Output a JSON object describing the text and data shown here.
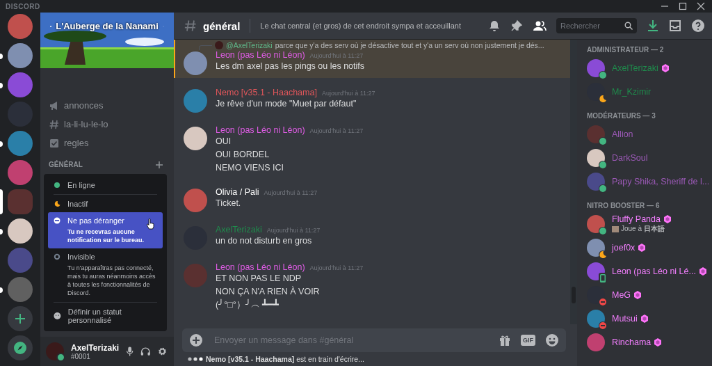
{
  "app_title": "DISCORD",
  "servers": [
    {
      "selected": false,
      "unread": false
    },
    {
      "selected": false,
      "unread": true
    },
    {
      "selected": false,
      "unread": true
    },
    {
      "selected": false,
      "unread": false
    },
    {
      "selected": false,
      "unread": true
    },
    {
      "selected": false,
      "unread": false
    },
    {
      "selected": true,
      "unread": false
    },
    {
      "selected": false,
      "unread": true
    },
    {
      "selected": false,
      "unread": false
    },
    {
      "selected": false,
      "unread": true
    }
  ],
  "guild": {
    "name": "L'Auberge de la Nanami"
  },
  "channels": [
    {
      "kind": "announcement",
      "name": "annonces"
    },
    {
      "kind": "text",
      "name": "la-li-lu-le-lo"
    },
    {
      "kind": "rules",
      "name": "regles"
    }
  ],
  "category": "GÉNÉRAL",
  "status_menu": [
    {
      "kind": "online",
      "label": "En ligne",
      "selected": false
    },
    {
      "kind": "idle",
      "label": "Inactif",
      "selected": false
    },
    {
      "kind": "dnd",
      "label": "Ne pas déranger",
      "description": "Tu ne recevras aucune notification sur le bureau.",
      "selected": true
    },
    {
      "kind": "invisible",
      "label": "Invisible",
      "description": "Tu n'apparaîtras pas connecté, mais tu auras néanmoins accès à toutes les fonctionnalités de Discord.",
      "selected": false
    },
    {
      "kind": "custom",
      "label": "Définir un statut personnalisé",
      "selected": false
    }
  ],
  "user": {
    "name": "AxelTerizaki",
    "tag": "#0001",
    "kind": "online"
  },
  "channel_header": {
    "name": "général",
    "topic": "Le chat central (et gros) de cet endroit sympa et acceuillant",
    "search_placeholder": "Rechercher"
  },
  "messages": [
    {
      "author": "Leon (pas Léo ni Léon)",
      "color": "#e05de6",
      "time": "Aujourd'hui à 11:27",
      "highlighted": true,
      "reply": {
        "mention": "@AxelTerizaki",
        "text": "parce que y'a des serv où je désactive tout et y'a un serv où non justement je dés..."
      },
      "lines": [
        "Les dm axel pas les pings ou les notifs"
      ]
    },
    {
      "author": "Nemo [v35.1 - Haachama]",
      "color": "#e0565a",
      "time": "Aujourd'hui à 11:27",
      "highlighted": false,
      "lines": [
        "Je rêve d'un mode \"Muet par défaut\""
      ]
    },
    {
      "author": "Leon (pas Léo ni Léon)",
      "color": "#e05de6",
      "time": "Aujourd'hui à 11:27",
      "highlighted": false,
      "lines": [
        "OUI",
        "OUI BORDEL",
        "NEMO VIENS ICI"
      ]
    },
    {
      "author": "Olivia / Pali",
      "color": "#ffffff",
      "time": "Aujourd'hui à 11:27",
      "highlighted": false,
      "lines": [
        "Ticket."
      ]
    },
    {
      "author": "AxelTerizaki",
      "color": "#1f8b4c",
      "time": "Aujourd'hui à 11:27",
      "highlighted": false,
      "lines": [
        "un do not disturb en gros"
      ]
    },
    {
      "author": "Leon (pas Léo ni Léon)",
      "color": "#e05de6",
      "time": "Aujourd'hui à 11:27",
      "highlighted": false,
      "lines": [
        "ET NON PAS LE NDP",
        "NON ÇA N'A RIEN À VOIR",
        "(╯°□°）╯︵ ┻━┻"
      ]
    }
  ],
  "composer": {
    "placeholder": "Envoyer un message dans #général",
    "gif_label": "GIF"
  },
  "typing": {
    "who": "Nemo [v35.1 - Haachama]",
    "text": "est en train d'écrire..."
  },
  "member_groups": [
    {
      "title": "ADMINISTRATEUR — 2",
      "members": [
        {
          "name": "AxelTerizaki",
          "color": "#1f8b4c",
          "kind": "online",
          "booster": true
        },
        {
          "name": "Mr_Kzimir",
          "color": "#1f8b4c",
          "kind": "idle",
          "booster": false
        }
      ]
    },
    {
      "title": "MODÉRATEURS — 3",
      "members": [
        {
          "name": "Allion",
          "color": "#9b59b6",
          "kind": "online",
          "booster": false
        },
        {
          "name": "DarkSoul",
          "color": "#9b59b6",
          "kind": "online",
          "booster": false
        },
        {
          "name": "Papy Shika, Sheriff de l...",
          "color": "#9b59b6",
          "kind": "online",
          "booster": false
        }
      ]
    },
    {
      "title": "NITRO BOOSTER — 6",
      "members": [
        {
          "name": "Fluffy Panda",
          "color": "#f47fff",
          "kind": "online",
          "booster": true,
          "activity": "Joue à **日本語**"
        },
        {
          "name": "joef0x",
          "color": "#f47fff",
          "kind": "idle",
          "booster": true
        },
        {
          "name": "Leon (pas Léo ni Lé...",
          "color": "#f47fff",
          "kind": "mobile",
          "booster": true
        },
        {
          "name": "MeG",
          "color": "#f47fff",
          "kind": "dnd",
          "booster": true
        },
        {
          "name": "Mutsui",
          "color": "#f47fff",
          "kind": "dnd",
          "booster": true
        },
        {
          "name": "Rinchama",
          "color": "#f47fff",
          "kind": "plain",
          "booster": true
        }
      ]
    }
  ]
}
